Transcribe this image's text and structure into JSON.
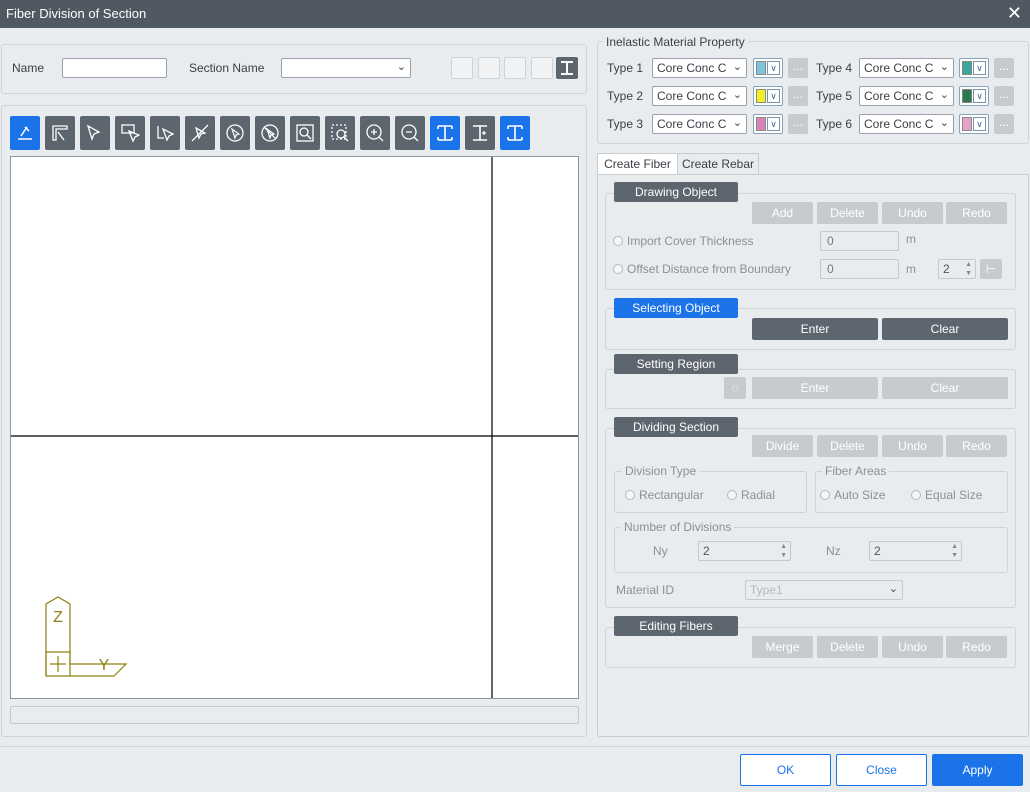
{
  "window": {
    "title": "Fiber Division of Section",
    "close_glyph": "✕"
  },
  "top": {
    "name_label": "Name",
    "name_value": "",
    "section_name_label": "Section Name",
    "section_name_value": ""
  },
  "material": {
    "title": "Inelastic Material Property",
    "more_label": "...",
    "types": [
      {
        "label": "Type 1",
        "value": "Core Conc C",
        "color": "#7ec3e0"
      },
      {
        "label": "Type 2",
        "value": "Core Conc C",
        "color": "#f3f021"
      },
      {
        "label": "Type 3",
        "value": "Core Conc C",
        "color": "#d882b9"
      },
      {
        "label": "Type 4",
        "value": "Core Conc C",
        "color": "#3aa7a1"
      },
      {
        "label": "Type 5",
        "value": "Core Conc C",
        "color": "#2a7a4e"
      },
      {
        "label": "Type 6",
        "value": "Core Conc C",
        "color": "#e7a3c4"
      }
    ]
  },
  "tabs": {
    "create_fiber": "Create Fiber",
    "create_rebar": "Create Rebar"
  },
  "drawing": {
    "header": "Drawing Object",
    "add": "Add",
    "delete": "Delete",
    "undo": "Undo",
    "redo": "Redo",
    "import_cover": "Import Cover Thickness",
    "import_value": "0",
    "unit1": "m",
    "offset": "Offset Distance from Boundary",
    "offset_value": "0",
    "unit2": "m",
    "offset_count": "2"
  },
  "selecting": {
    "header": "Selecting Object",
    "enter": "Enter",
    "clear": "Clear"
  },
  "region": {
    "header": "Setting Region",
    "enter": "Enter",
    "clear": "Clear"
  },
  "dividing": {
    "header": "Dividing Section",
    "divide": "Divide",
    "delete": "Delete",
    "undo": "Undo",
    "redo": "Redo",
    "division_type": "Division Type",
    "rectangular": "Rectangular",
    "radial": "Radial",
    "fiber_areas": "Fiber Areas",
    "auto_size": "Auto Size",
    "equal_size": "Equal Size",
    "num_divisions": "Number of Divisions",
    "ny_label": "Ny",
    "ny_value": "2",
    "nz_label": "Nz",
    "nz_value": "2",
    "material_id_label": "Material ID",
    "material_id_value": "Type1"
  },
  "editing": {
    "header": "Editing Fibers",
    "merge": "Merge",
    "delete": "Delete",
    "undo": "Undo",
    "redo": "Redo"
  },
  "axis": {
    "z": "Z",
    "y": "Y"
  },
  "footer": {
    "ok": "OK",
    "close": "Close",
    "apply": "Apply"
  }
}
